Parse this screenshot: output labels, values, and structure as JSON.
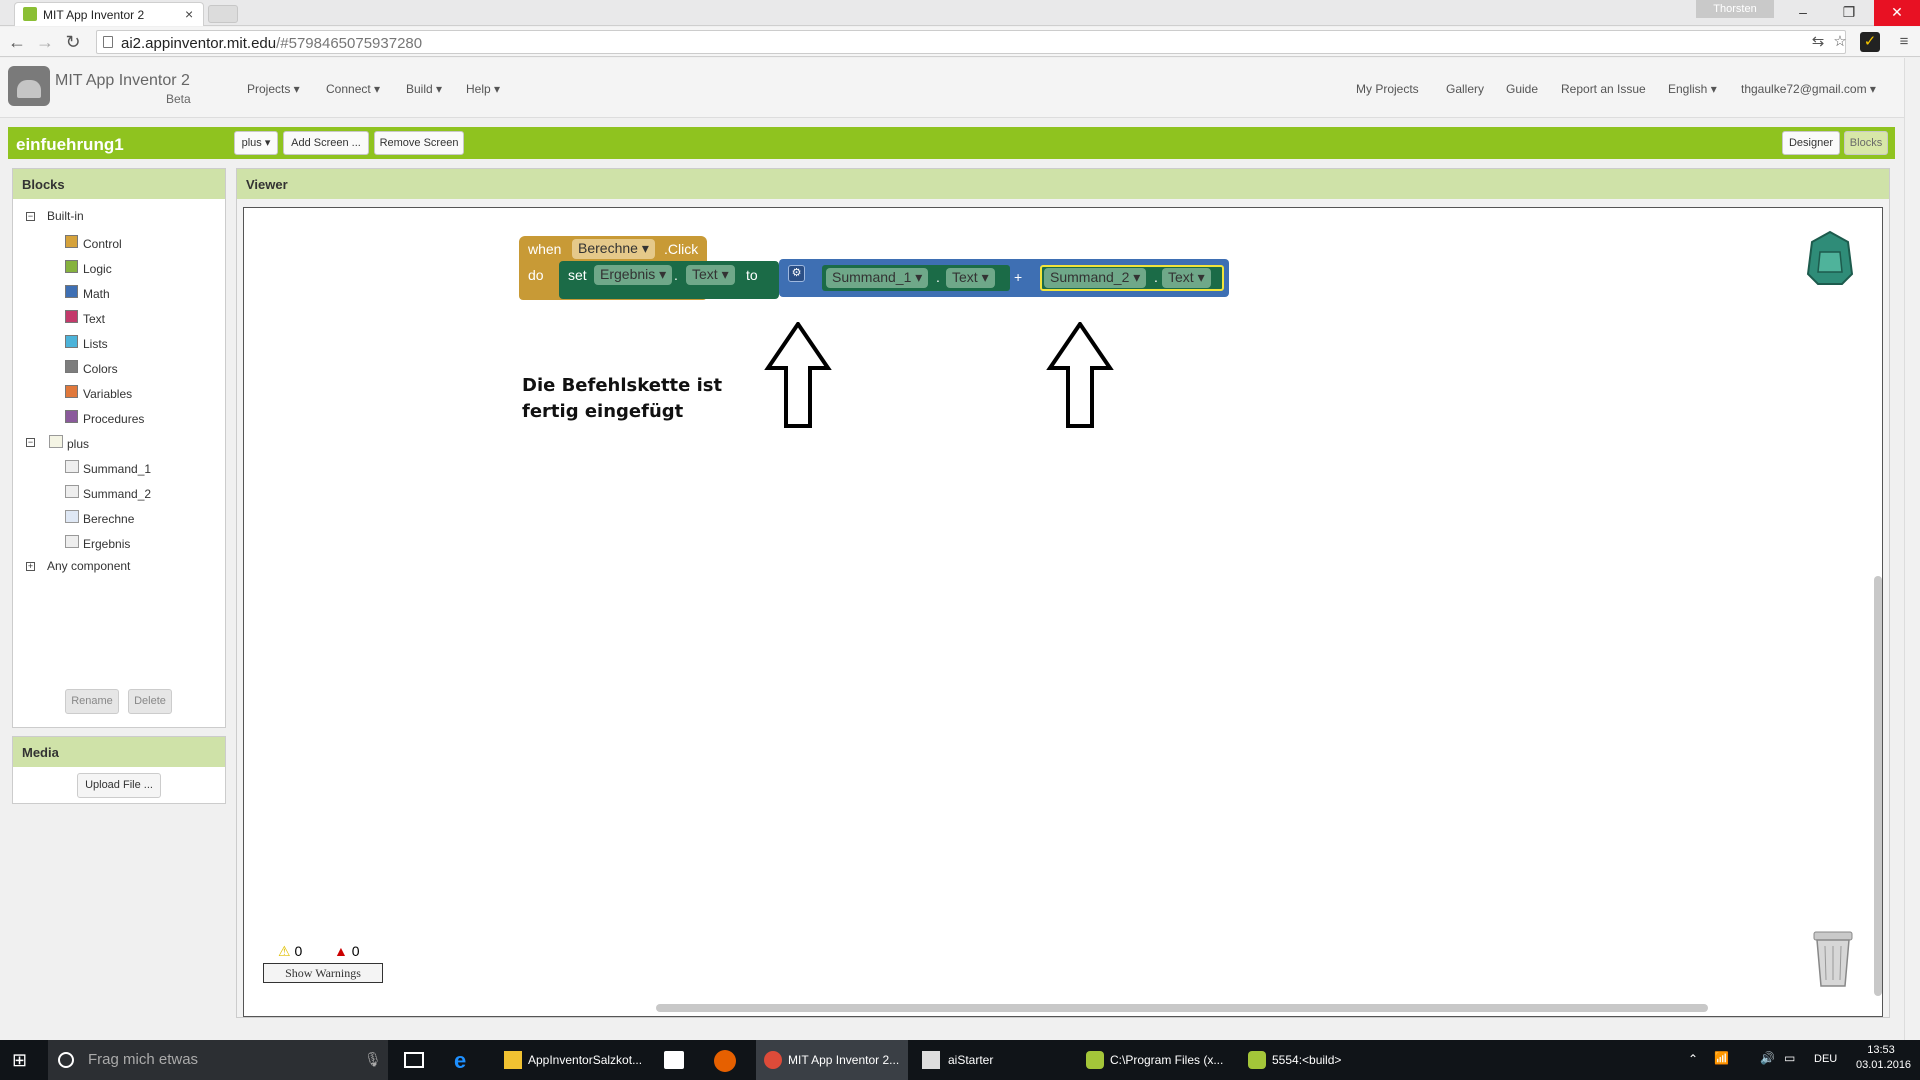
{
  "browser": {
    "tab_title": "MIT App Inventor 2",
    "user_badge": "Thorsten",
    "url_host": "ai2.appinventor.mit.edu",
    "url_path": "/#5798465075937280"
  },
  "app": {
    "title": "MIT App Inventor 2",
    "subtitle": "Beta",
    "menus_left": [
      "Projects ▾",
      "Connect ▾",
      "Build ▾",
      "Help ▾"
    ],
    "menus_right": [
      "My Projects",
      "Gallery",
      "Guide",
      "Report an Issue",
      "English ▾",
      "thgaulke72@gmail.com ▾"
    ]
  },
  "project": {
    "name": "einfuehrung1",
    "screen_select": "plus ▾",
    "add_screen": "Add Screen ...",
    "remove_screen": "Remove Screen",
    "designer": "Designer",
    "blocks": "Blocks"
  },
  "blocks_panel": {
    "title": "Blocks",
    "builtin_label": "Built-in",
    "builtin_items": [
      {
        "label": "Control",
        "color": "#d5a23b"
      },
      {
        "label": "Logic",
        "color": "#86b23e"
      },
      {
        "label": "Math",
        "color": "#3e6fb3"
      },
      {
        "label": "Text",
        "color": "#c33a6b"
      },
      {
        "label": "Lists",
        "color": "#4cb3d9"
      },
      {
        "label": "Colors",
        "color": "#7d7d7d"
      },
      {
        "label": "Variables",
        "color": "#e0783b"
      },
      {
        "label": "Procedures",
        "color": "#8a5a9b"
      }
    ],
    "screen_label": "plus",
    "components": [
      "Summand_1",
      "Summand_2",
      "Berechne",
      "Ergebnis"
    ],
    "any_component": "Any component",
    "rename": "Rename",
    "delete": "Delete"
  },
  "media_panel": {
    "title": "Media",
    "upload": "Upload File ..."
  },
  "viewer": {
    "title": "Viewer",
    "event_when": "when",
    "event_component": "Berechne ▾",
    "event_name": ".Click",
    "do": "do",
    "set": "set",
    "set_component": "Ergebnis ▾",
    "dot": ".",
    "set_prop": "Text ▾",
    "to": "to",
    "operand1_component": "Summand_1 ▾",
    "operand1_prop": "Text ▾",
    "plus": "+",
    "operand2_component": "Summand_2 ▾",
    "operand2_prop": "Text ▾",
    "note_line1": "Die Befehlskette ist",
    "note_line2": "fertig eingefügt",
    "warnings_count": "0",
    "errors_count": "0",
    "show_warnings": "Show Warnings"
  },
  "taskbar": {
    "search_placeholder": "Frag mich etwas",
    "items": [
      "AppInventorSalzkot...",
      "MIT App Inventor 2...",
      "aiStarter",
      "C:\\Program Files (x...",
      "5554:<build>"
    ],
    "lang": "DEU",
    "time": "13:53",
    "date": "03.01.2016"
  }
}
